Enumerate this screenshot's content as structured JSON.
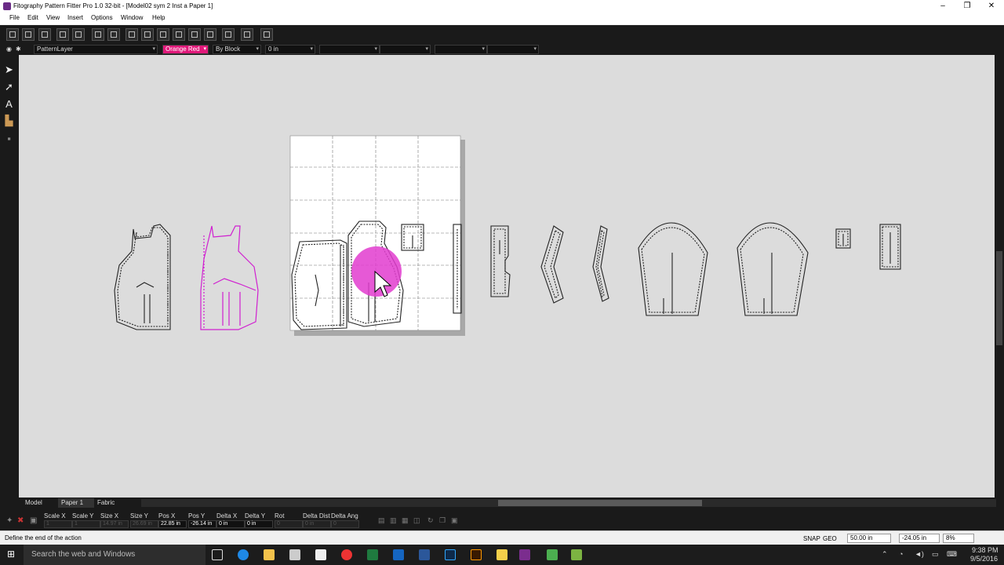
{
  "window": {
    "title": "Fitography Pattern Fitter Pro 1.0 32-bit - [Model02 sym 2 Inst a Paper 1]",
    "minimize": "–",
    "maximize": "❐",
    "close": "✕"
  },
  "menu": [
    "File",
    "Edit",
    "View",
    "Insert",
    "Options",
    "Window",
    "Help"
  ],
  "propbar": {
    "layer": "PatternLayer",
    "color": "Orange Red",
    "linetype": "By Block",
    "width": "0 in"
  },
  "tabs": [
    "Model",
    "Paper 1",
    "Fabric"
  ],
  "info": {
    "headers": [
      "Scale X",
      "Scale Y",
      "Size X",
      "Size Y",
      "Pos X",
      "Pos Y",
      "Delta X",
      "Delta Y",
      "Rot",
      "Delta Dist",
      "Delta Ang"
    ],
    "values": [
      "1",
      "1",
      "14.97 in",
      "26.69 in",
      "22.85 in",
      "-26.14 in",
      "0 in",
      "0 in",
      "0",
      "0 in",
      "0"
    ]
  },
  "status": {
    "message": "Define the end of the action",
    "snap": "SNAP",
    "geo": "GEO",
    "coord_x": "50.00 in",
    "coord_y": "-24.05 in",
    "zoom": "8%"
  },
  "taskbar": {
    "search_placeholder": "Search the web and Windows",
    "time": "9:38 PM",
    "date": "9/5/2016"
  },
  "colors": {
    "accent_layer": "#e0187a",
    "highlight_circle": "#e23ccf",
    "pattern_magenta": "#d01fd0",
    "canvas_bg": "#dcdcdc"
  }
}
